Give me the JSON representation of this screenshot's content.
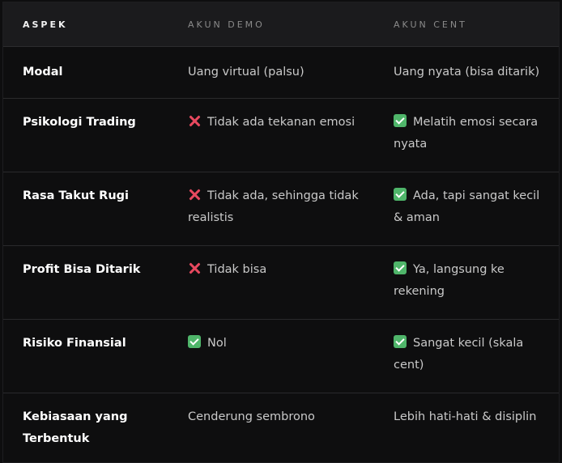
{
  "table": {
    "headers": [
      "ASPEK",
      "AKUN DEMO",
      "AKUN CENT"
    ],
    "rows": [
      {
        "aspek": "Modal",
        "demo": {
          "icon": "",
          "text": "Uang virtual (palsu)"
        },
        "cent": {
          "icon": "",
          "text": "Uang nyata (bisa ditarik)"
        }
      },
      {
        "aspek": "Psikologi Trading",
        "demo": {
          "icon": "cross-icon",
          "text": "Tidak ada tekanan emosi"
        },
        "cent": {
          "icon": "check-icon",
          "text": "Melatih emosi secara nyata"
        }
      },
      {
        "aspek": "Rasa Takut Rugi",
        "demo": {
          "icon": "cross-icon",
          "text": "Tidak ada, sehingga tidak realistis"
        },
        "cent": {
          "icon": "check-icon",
          "text": "Ada, tapi sangat kecil & aman"
        }
      },
      {
        "aspek": "Profit Bisa Ditarik",
        "demo": {
          "icon": "cross-icon",
          "text": "Tidak bisa"
        },
        "cent": {
          "icon": "check-icon",
          "text": "Ya, langsung ke rekening"
        }
      },
      {
        "aspek": "Risiko Finansial",
        "demo": {
          "icon": "check-icon",
          "text": "Nol"
        },
        "cent": {
          "icon": "check-icon",
          "text": "Sangat kecil (skala cent)"
        }
      },
      {
        "aspek": "Kebiasaan yang Terbentuk",
        "demo": {
          "icon": "",
          "text": "Cenderung sembrono"
        },
        "cent": {
          "icon": "",
          "text": "Lebih hati-hati & disiplin"
        }
      }
    ]
  },
  "colors": {
    "check": "#4fb56a",
    "cross": "#e8495f",
    "background": "#0e0e0f",
    "header_background": "#1b1b1d"
  }
}
